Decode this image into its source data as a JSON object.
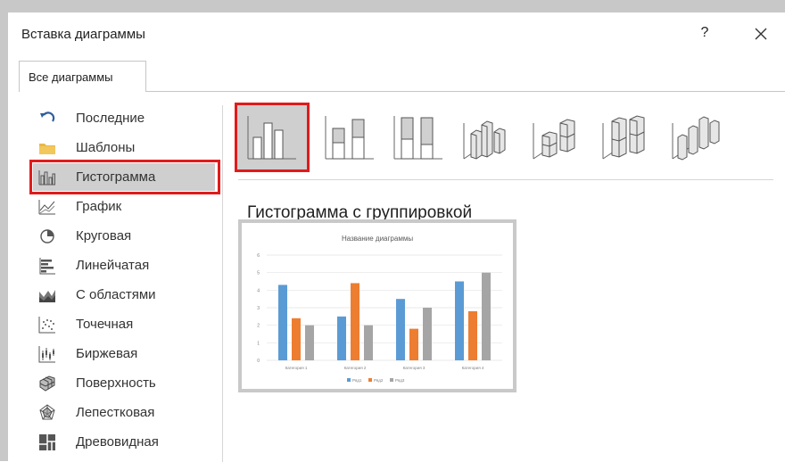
{
  "dialog": {
    "title": "Вставка диаграммы",
    "help_label": "?"
  },
  "tabs": [
    {
      "label": "Все диаграммы"
    }
  ],
  "sidebar": {
    "items": [
      {
        "label": "Последние",
        "icon": "recent-icon"
      },
      {
        "label": "Шаблоны",
        "icon": "folder-icon"
      },
      {
        "label": "Гистограмма",
        "icon": "column-chart-icon",
        "selected": true
      },
      {
        "label": "График",
        "icon": "line-chart-icon"
      },
      {
        "label": "Круговая",
        "icon": "pie-chart-icon"
      },
      {
        "label": "Линейчатая",
        "icon": "bar-chart-icon"
      },
      {
        "label": "С областями",
        "icon": "area-chart-icon"
      },
      {
        "label": "Точечная",
        "icon": "scatter-chart-icon"
      },
      {
        "label": "Биржевая",
        "icon": "stock-chart-icon"
      },
      {
        "label": "Поверхность",
        "icon": "surface-chart-icon"
      },
      {
        "label": "Лепестковая",
        "icon": "radar-chart-icon"
      },
      {
        "label": "Древовидная",
        "icon": "treemap-chart-icon"
      }
    ]
  },
  "subtypes": [
    {
      "icon": "clustered-column-icon",
      "selected": true
    },
    {
      "icon": "stacked-column-icon"
    },
    {
      "icon": "stacked-100-column-icon"
    },
    {
      "icon": "3d-clustered-column-icon"
    },
    {
      "icon": "3d-stacked-column-icon"
    },
    {
      "icon": "3d-stacked-100-column-icon"
    },
    {
      "icon": "3d-column-icon"
    }
  ],
  "selected_subtype_title": "Гистограмма с группировкой",
  "colors": {
    "selection_border": "#e11b1b",
    "series1": "#5b9bd5",
    "series2": "#ed7d31",
    "series3": "#a5a5a5"
  },
  "chart_data": {
    "type": "bar",
    "title": "Название диаграммы",
    "categories": [
      "Категория 1",
      "Категория 2",
      "Категория 3",
      "Категория 4"
    ],
    "series": [
      {
        "name": "Ряд1",
        "values": [
          4.3,
          2.5,
          3.5,
          4.5
        ]
      },
      {
        "name": "Ряд2",
        "values": [
          2.4,
          4.4,
          1.8,
          2.8
        ]
      },
      {
        "name": "Ряд3",
        "values": [
          2,
          2,
          3,
          5
        ]
      }
    ],
    "yticks": [
      "0",
      "1",
      "2",
      "3",
      "4",
      "5",
      "6"
    ],
    "ylim": [
      0,
      6
    ],
    "grid": true,
    "legend": "bottom"
  }
}
